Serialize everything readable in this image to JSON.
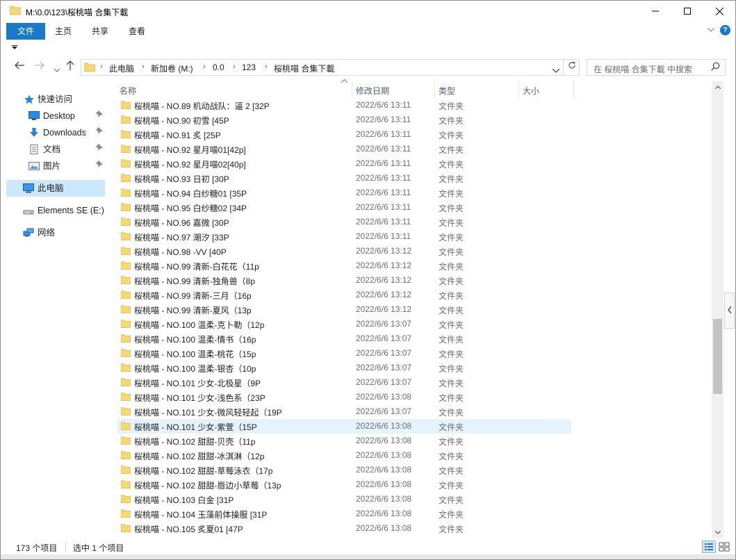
{
  "window": {
    "title": "M:\\0.0\\123\\桜桃喵 合集下載"
  },
  "ribbon": {
    "tabs": [
      "文件",
      "主页",
      "共享",
      "查看"
    ],
    "help": "?"
  },
  "address": {
    "segments": [
      "此电脑",
      "新加卷 (M:)",
      "0.0",
      "123",
      "桜桃喵 合集下載"
    ],
    "search_placeholder": "在 桜桃喵 合集下載 中搜索"
  },
  "nav_pane": {
    "quick_access": "快速访问",
    "items": [
      {
        "label": "Desktop",
        "pinned": true,
        "icon": "desktop-icon"
      },
      {
        "label": "Downloads",
        "pinned": true,
        "icon": "downloads-icon"
      },
      {
        "label": "文档",
        "pinned": true,
        "icon": "documents-icon"
      },
      {
        "label": "图片",
        "pinned": true,
        "icon": "pictures-icon"
      }
    ],
    "this_pc": "此电脑",
    "drive": "Elements SE (E:)",
    "network": "网络"
  },
  "columns": {
    "name": "名称",
    "date": "修改日期",
    "type": "类型",
    "size": "大小"
  },
  "files": [
    {
      "name": "桜桃喵 - NO.89 机动战队：逼 2 [32P",
      "date": "2022/6/6 13:11",
      "type": "文件夹"
    },
    {
      "name": "桜桃喵 - NO.90 初雪 [45P",
      "date": "2022/6/6 13:11",
      "type": "文件夹"
    },
    {
      "name": "桜桃喵 - NO.91 炙 [25P",
      "date": "2022/6/6 13:11",
      "type": "文件夹"
    },
    {
      "name": "桜桃喵 - NO.92 星月喵01[42p]",
      "date": "2022/6/6 13:11",
      "type": "文件夹"
    },
    {
      "name": "桜桃喵 - NO.92 星月喵02[40p]",
      "date": "2022/6/6 13:11",
      "type": "文件夹"
    },
    {
      "name": "桜桃喵 - NO.93 日初 [30P",
      "date": "2022/6/6 13:11",
      "type": "文件夹"
    },
    {
      "name": "桜桃喵 - NO.94 白纱糖01 [35P",
      "date": "2022/6/6 13:11",
      "type": "文件夹"
    },
    {
      "name": "桜桃喵 - NO.95 白纱糖02 [34P",
      "date": "2022/6/6 13:11",
      "type": "文件夹"
    },
    {
      "name": "桜桃喵 - NO.96 嘉微 [30P",
      "date": "2022/6/6 13:11",
      "type": "文件夹"
    },
    {
      "name": "桜桃喵 - NO.97 潮汐 [33P",
      "date": "2022/6/6 13:11",
      "type": "文件夹"
    },
    {
      "name": "桜桃喵 - NO.98 -VV [40P",
      "date": "2022/6/6 13:12",
      "type": "文件夹"
    },
    {
      "name": "桜桃喵 - NO.99 清新-白花花（11p",
      "date": "2022/6/6 13:12",
      "type": "文件夹"
    },
    {
      "name": "桜桃喵 - NO.99 清新-独角兽（8p",
      "date": "2022/6/6 13:12",
      "type": "文件夹"
    },
    {
      "name": "桜桃喵 - NO.99 清新-三月（16p",
      "date": "2022/6/6 13:12",
      "type": "文件夹"
    },
    {
      "name": "桜桃喵 - NO.99 清新-夏风（13p",
      "date": "2022/6/6 13:12",
      "type": "文件夹"
    },
    {
      "name": "桜桃喵 - NO.100 温柔-克卜勒（12p",
      "date": "2022/6/6 13:07",
      "type": "文件夹"
    },
    {
      "name": "桜桃喵 - NO.100 温柔-情书（16p",
      "date": "2022/6/6 13:07",
      "type": "文件夹"
    },
    {
      "name": "桜桃喵 - NO.100 温柔-桃花（15p",
      "date": "2022/6/6 13:07",
      "type": "文件夹"
    },
    {
      "name": "桜桃喵 - NO.100 温柔-银杏（10p",
      "date": "2022/6/6 13:07",
      "type": "文件夹"
    },
    {
      "name": "桜桃喵 - NO.101 少女-北极星（9P",
      "date": "2022/6/6 13:07",
      "type": "文件夹"
    },
    {
      "name": "桜桃喵 - NO.101 少女-浅色系（23P",
      "date": "2022/6/6 13:08",
      "type": "文件夹"
    },
    {
      "name": "桜桃喵 - NO.101 少女-微风轻轻起（19P",
      "date": "2022/6/6 13:07",
      "type": "文件夹"
    },
    {
      "name": "桜桃喵 - NO.101 少女-紫萱（15P",
      "date": "2022/6/6 13:08",
      "type": "文件夹"
    },
    {
      "name": "桜桃喵 - NO.102 甜甜-贝壳（11p",
      "date": "2022/6/6 13:08",
      "type": "文件夹"
    },
    {
      "name": "桜桃喵 - NO.102 甜甜-冰淇淋（12p",
      "date": "2022/6/6 13:08",
      "type": "文件夹"
    },
    {
      "name": "桜桃喵 - NO.102 甜甜-草莓泳衣（17p",
      "date": "2022/6/6 13:08",
      "type": "文件夹"
    },
    {
      "name": "桜桃喵 - NO.102 甜甜-唇边小草莓（13p",
      "date": "2022/6/6 13:08",
      "type": "文件夹"
    },
    {
      "name": "桜桃喵 - NO.103 白金 [31P",
      "date": "2022/6/6 13:08",
      "type": "文件夹"
    },
    {
      "name": "桜桃喵 - NO.104 玉藻前体操服 [31P",
      "date": "2022/6/6 13:08",
      "type": "文件夹"
    },
    {
      "name": "桜桃喵 - NO.105 炙夏01 [47P",
      "date": "2022/6/6 13:08",
      "type": "文件夹"
    }
  ],
  "selected_index": 22,
  "status": {
    "count": "173 个项目",
    "selected": "选中 1 个项目"
  },
  "colors": {
    "accent": "#1979ca",
    "selection": "#cce8ff",
    "hover_row": "#e5f3ff",
    "folder": "#f8d775"
  }
}
